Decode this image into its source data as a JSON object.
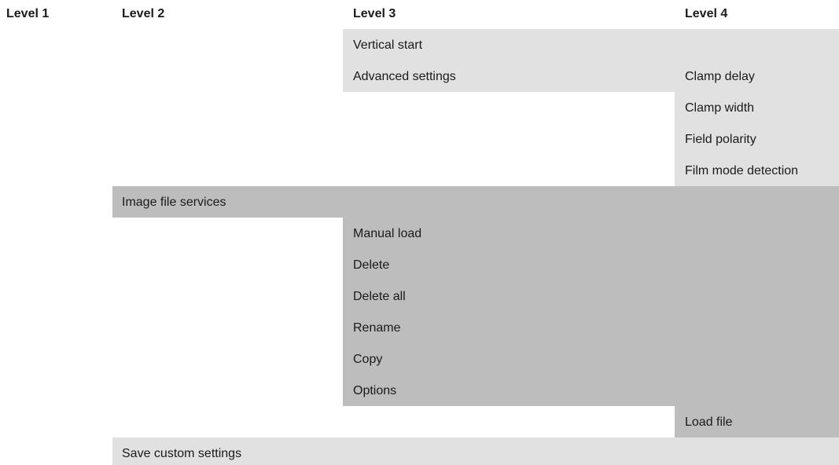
{
  "headers": {
    "level1": "Level 1",
    "level2": "Level 2",
    "level3": "Level 3",
    "level4": "Level 4"
  },
  "menu": {
    "vertical_start": "Vertical start",
    "advanced_settings": "Advanced settings",
    "clamp_delay": "Clamp delay",
    "clamp_width": "Clamp width",
    "field_polarity": "Field polarity",
    "film_mode_detection": "Film mode detection",
    "image_file_services": "Image file services",
    "manual_load": "Manual load",
    "delete": "Delete",
    "delete_all": "Delete all",
    "rename": "Rename",
    "copy": "Copy",
    "options": "Options",
    "load_file": "Load file",
    "save_custom_settings": "Save custom settings"
  }
}
